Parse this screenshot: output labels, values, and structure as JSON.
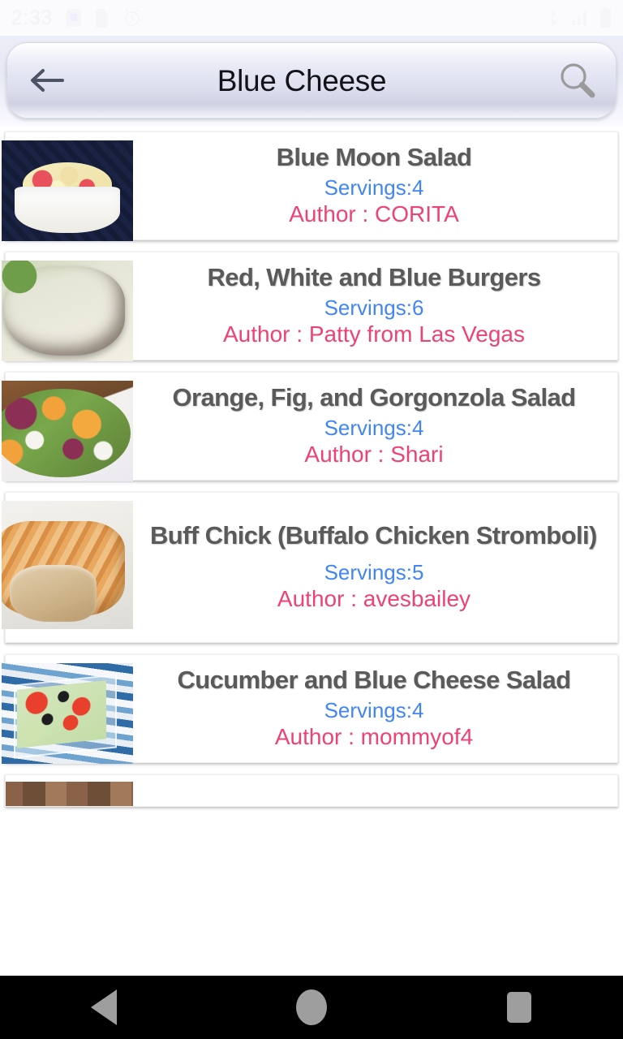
{
  "status_bar": {
    "time": "2:33",
    "left_icons": [
      "sim-card-icon",
      "sd-card-icon",
      "alarm-clock-icon"
    ],
    "right_icons": [
      "bluetooth-icon",
      "signal-icon",
      "battery-icon"
    ]
  },
  "search": {
    "back_icon": "arrow-left-icon",
    "query": "Blue Cheese",
    "placeholder": "Search",
    "search_icon": "magnifier-icon"
  },
  "labels": {
    "servings_prefix": "Servings:",
    "author_prefix": "Author : "
  },
  "colors": {
    "title": "#5a5a5a",
    "servings": "#4285f4",
    "author": "#ee4372",
    "card_bg": "#ffffff",
    "page_bg": "#ffffff",
    "navbar_bg": "#000000",
    "nav_icon": "#9e9e9e"
  },
  "results": [
    {
      "title": "Blue Moon Salad",
      "servings": "Servings:4",
      "author": "Author : CORITA",
      "thumb": "salad-in-white-bowl-photo"
    },
    {
      "title": "Red, White and Blue Burgers",
      "servings": "Servings:6",
      "author": "Author : Patty from Las Vegas",
      "thumb": "burger-patty-photo"
    },
    {
      "title": "Orange, Fig, and Gorgonzola Salad",
      "servings": "Servings:4",
      "author": "Author : Shari",
      "thumb": "fig-orange-salad-photo"
    },
    {
      "title": "Buff Chick (Buffalo Chicken Stromboli)",
      "servings": "Servings:5",
      "author": "Author : avesbailey",
      "thumb": "stromboli-photo"
    },
    {
      "title": "Cucumber and Blue Cheese Salad",
      "servings": "Servings:4",
      "author": "Author : mommyof4",
      "thumb": "cucumber-salad-photo"
    },
    {
      "title": "",
      "servings": "",
      "author": "",
      "thumb": "partially-visible-recipe-photo"
    }
  ],
  "navbar": {
    "back": "back-triangle-icon",
    "home": "home-circle-icon",
    "recents": "recents-square-icon"
  }
}
